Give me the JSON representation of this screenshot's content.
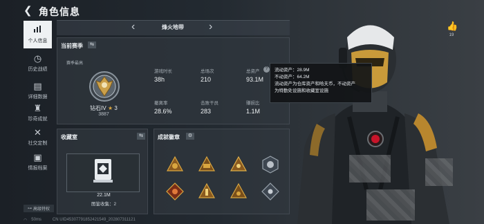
{
  "header": {
    "title": "角色信息"
  },
  "sidebar": {
    "items": [
      {
        "label": "个人信息",
        "icon": "bar-chart-icon",
        "active": true
      },
      {
        "label": "历史战绩",
        "icon": "history-icon",
        "active": false
      },
      {
        "label": "详细数据",
        "icon": "report-icon",
        "active": false
      },
      {
        "label": "珍奇成就",
        "icon": "trophy-icon",
        "active": false
      },
      {
        "label": "社交定制",
        "icon": "tools-icon",
        "active": false
      },
      {
        "label": "情报档案",
        "icon": "archive-icon",
        "active": false
      }
    ],
    "privacy_label": "高级特权"
  },
  "status": {
    "signal": "50ms",
    "uid": "CN UID45307791852421549_202807311121"
  },
  "season": {
    "name": "烽火地带"
  },
  "current_season": {
    "label": "当前赛季",
    "best_label": "赛季最高",
    "rank": "钻石IV",
    "stars": "3",
    "score": "3887",
    "stats": [
      {
        "label": "游戏时长",
        "value": "38h"
      },
      {
        "label": "总场次",
        "value": "210"
      },
      {
        "label": "总资产",
        "value": "93.1M"
      },
      {
        "label": "撤离率",
        "value": "28.6%"
      },
      {
        "label": "击败干员",
        "value": "283"
      },
      {
        "label": "赚损比",
        "value": "1.1M"
      }
    ]
  },
  "tooltip": {
    "line1": "流动资产：28.9M",
    "line2": "不动资产：64.2M",
    "line3": "流动资产为仓库资产和哈夫币，不动资产",
    "line4": "为特勤处设施和收藏室设施"
  },
  "collection": {
    "label": "收藏室",
    "value": "22.1M",
    "count_text": "图鉴收集：2"
  },
  "medals": {
    "label": "成就徽章"
  },
  "likes": {
    "count": "19"
  },
  "colors": {
    "accent_red": "#c8142a",
    "gold": "#d9a640",
    "panel": "#30373e"
  }
}
